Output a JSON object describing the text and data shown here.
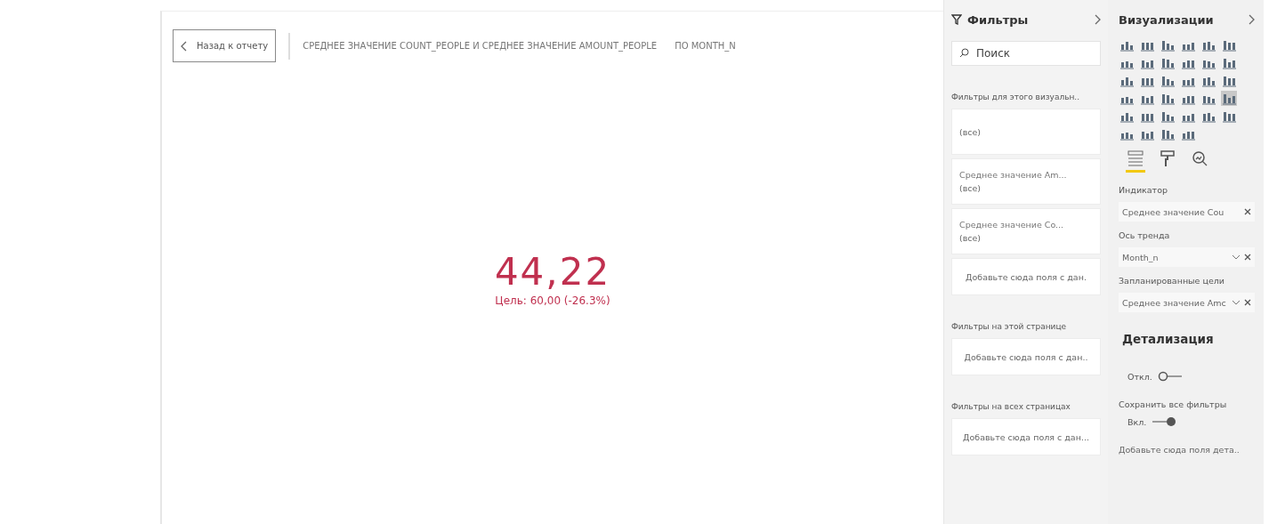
{
  "canvas": {
    "back_button": "Назад к отчету",
    "title": "СРЕДНЕЕ ЗНАЧЕНИЕ COUNT_PEOPLE И СРЕДНЕЕ ЗНАЧЕНИЕ AMOUNT_PEOPLE",
    "title_suffix": "ПО MONTH_N",
    "kpi": {
      "value": "44,22",
      "goal": "Цель: 60,00 (-26.3%)",
      "color": "#c0304f"
    }
  },
  "filters": {
    "title": "Фильтры",
    "search": {
      "placeholder": "Поиск"
    },
    "sections": [
      {
        "heading": "Фильтры для этого визуальн..",
        "cards": [
          {
            "value": "(все)"
          },
          {
            "name": "Среднее значение Am...",
            "value": "(все)"
          },
          {
            "name": "Среднее значение Co...",
            "value": "(все)"
          }
        ],
        "drop_hint": "Добавьте сюда поля с дан."
      },
      {
        "heading": "Фильтры на этой странице",
        "drop_hint": "Добавьте сюда поля с дан.."
      },
      {
        "heading": "Фильтры на всех страницах",
        "drop_hint": "Добавьте сюда поля с дан..."
      }
    ]
  },
  "visualizations": {
    "title": "Визуализации",
    "types": [
      {
        "selected": false
      },
      {
        "selected": false
      },
      {
        "selected": false
      },
      {
        "selected": false
      },
      {
        "selected": false
      },
      {
        "selected": false
      },
      {
        "selected": false
      },
      {
        "selected": false
      },
      {
        "selected": false
      },
      {
        "selected": false
      },
      {
        "selected": false
      },
      {
        "selected": false
      },
      {
        "selected": false
      },
      {
        "selected": false
      },
      {
        "selected": false
      },
      {
        "selected": false
      },
      {
        "selected": false
      },
      {
        "selected": false
      },
      {
        "selected": false
      },
      {
        "selected": false
      },
      {
        "selected": false
      },
      {
        "selected": false
      },
      {
        "selected": false
      },
      {
        "selected": true
      },
      {
        "selected": false
      },
      {
        "selected": false
      },
      {
        "selected": false
      },
      {
        "selected": false
      },
      {
        "selected": false
      },
      {
        "selected": false
      },
      {
        "selected": false
      },
      {
        "selected": false
      },
      {
        "selected": false
      },
      {
        "selected": false
      }
    ],
    "pane_tabs": [
      {
        "selected": true
      },
      {
        "selected": false
      },
      {
        "selected": false
      }
    ],
    "wells": [
      {
        "label": "Индикатор",
        "field": "Среднее значение Cou",
        "dropdown": false
      },
      {
        "label": "Ось тренда",
        "field": "Month_n",
        "dropdown": true
      },
      {
        "label": "Запланированные цели",
        "field": "Среднее значение Amc",
        "dropdown": true
      }
    ],
    "drillthrough": {
      "title": "Детализация",
      "toggles": [
        {
          "state": "Откл.",
          "on": false
        },
        {
          "label": "Сохранить все фильтры",
          "state": "Вкл.",
          "on": true
        }
      ],
      "drop_hint": "Добавьте сюда поля дета.."
    }
  }
}
